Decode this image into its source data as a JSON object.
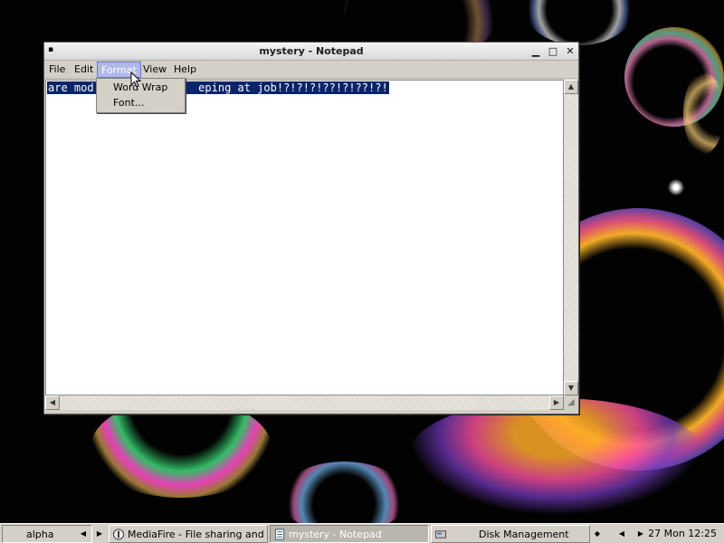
{
  "window": {
    "title": "mystery - Notepad",
    "minimize_glyph": "▁",
    "maximize_glyph": "□",
    "close_glyph": "✕"
  },
  "menubar": {
    "file": "File",
    "edit": "Edit",
    "format": "Format",
    "view": "View",
    "help": "Help"
  },
  "format_menu": {
    "word_wrap": "Word Wrap",
    "font": "Font..."
  },
  "editor": {
    "visible_text": "are mod                eping at job!?!?!?!??!?!??!?!",
    "selected": true
  },
  "taskbar": {
    "workspace": "alpha",
    "tasks": [
      {
        "label": "MediaFire - File sharing and s...",
        "icon": "browser-icon",
        "active": false
      },
      {
        "label": "mystery - Notepad",
        "icon": "notepad-icon",
        "active": true
      },
      {
        "label": "Disk Management",
        "icon": "disk-management-icon",
        "active": false
      }
    ],
    "clock": "27 Mon 12:25"
  },
  "colors": {
    "selection_bg": "#0a246a",
    "menu_highlight": "#b0b9e6",
    "chrome": "#d4d0c8"
  }
}
